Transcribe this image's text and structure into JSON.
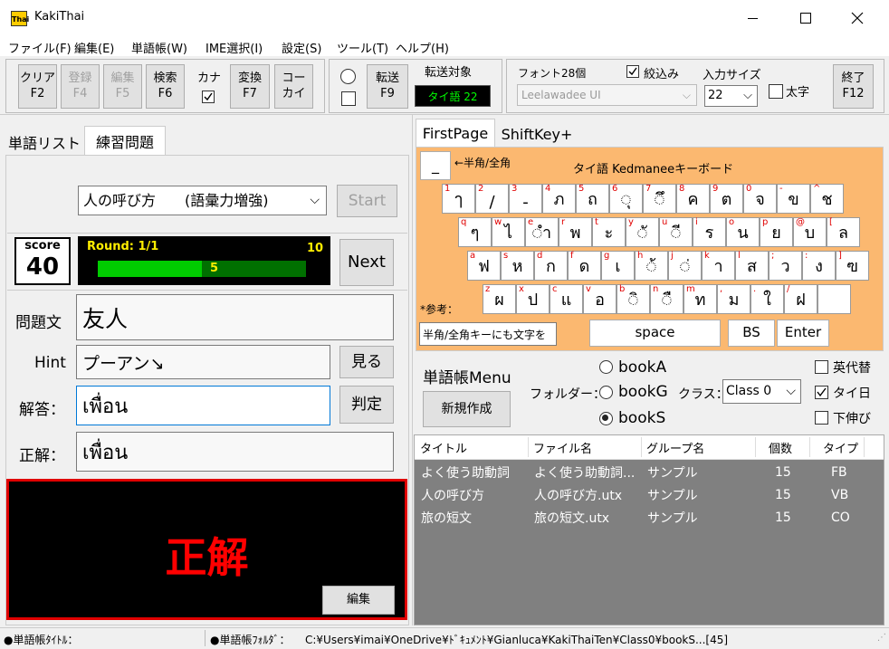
{
  "window": {
    "title": "KakiThai"
  },
  "menu": [
    "ファイル(F)",
    "編集(E)",
    "単語帳(W)",
    "IME選択(I)",
    "設定(S)",
    "ツール(T)",
    "ヘルプ(H)"
  ],
  "toolbar": {
    "clear": {
      "label": "クリア",
      "key": "F2"
    },
    "register": {
      "label": "登録",
      "key": "F4"
    },
    "edit": {
      "label": "編集",
      "key": "F5"
    },
    "search": {
      "label": "検索",
      "key": "F6"
    },
    "kana_label": "カナ",
    "convert": {
      "label": "変換",
      "key": "F7"
    },
    "kokai": {
      "label": "コー",
      "key": "カイ"
    },
    "transfer": {
      "label": "転送",
      "key": "F9"
    },
    "transfer_target_label": "転送対象",
    "transfer_target": "タイ語 22",
    "font_label": "フォント28個",
    "filter_label": "絞込み",
    "font_value": "Leelawadee UI",
    "input_size_label": "入力サイズ",
    "input_size_value": "22",
    "bold_label": "太字",
    "exit": {
      "label": "終了",
      "key": "F12"
    }
  },
  "left_tabs": [
    "単語リスト",
    "練習問題"
  ],
  "quiz": {
    "mode_value": "人の呼び方　　(語彙力増強)",
    "start_label": "Start",
    "score_label": "score",
    "score_value": "40",
    "round_label": "Round: 1/1",
    "progress_max": "10",
    "progress_value": "5",
    "progress_fraction": 0.5,
    "next_label": "Next",
    "question_label": "問題文",
    "question_value": "友人",
    "hint_label": "Hint",
    "hint_value": "プーアン↘",
    "show_label": "見る",
    "answer_label": "解答：",
    "answer_value": "เพื่อน",
    "judge_label": "判定",
    "correct_label": "正解：",
    "correct_value": "เพื่อน",
    "result_text": "正解",
    "edit_label": "編集"
  },
  "right_tabs": [
    "FirstPage",
    "ShiftKey+"
  ],
  "keyboard": {
    "toggle_key": "_",
    "toggle_label": "←半角/全角",
    "title": "タイ語 Kedmaneeキーボード",
    "rows": [
      [
        {
          "s": "1",
          "m": "ๅ"
        },
        {
          "s": "2",
          "m": "/"
        },
        {
          "s": "3",
          "m": "-"
        },
        {
          "s": "4",
          "m": "ภ"
        },
        {
          "s": "5",
          "m": "ถ"
        },
        {
          "s": "6",
          "m": "◌ุ"
        },
        {
          "s": "7",
          "m": "◌ึ"
        },
        {
          "s": "8",
          "m": "ค"
        },
        {
          "s": "9",
          "m": "ต"
        },
        {
          "s": "0",
          "m": "จ"
        },
        {
          "s": "-",
          "m": "ข"
        },
        {
          "s": "^",
          "m": "ช"
        }
      ],
      [
        {
          "s": "q",
          "m": "ๆ"
        },
        {
          "s": "w",
          "m": "ไ"
        },
        {
          "s": "e",
          "m": "◌ำ"
        },
        {
          "s": "r",
          "m": "พ"
        },
        {
          "s": "t",
          "m": "ะ"
        },
        {
          "s": "y",
          "m": "◌ั"
        },
        {
          "s": "u",
          "m": "◌ี"
        },
        {
          "s": "i",
          "m": "ร"
        },
        {
          "s": "o",
          "m": "น"
        },
        {
          "s": "p",
          "m": "ย"
        },
        {
          "s": "@",
          "m": "บ"
        },
        {
          "s": "[",
          "m": "ล"
        }
      ],
      [
        {
          "s": "a",
          "m": "ฟ"
        },
        {
          "s": "s",
          "m": "ห"
        },
        {
          "s": "d",
          "m": "ก"
        },
        {
          "s": "f",
          "m": "ด"
        },
        {
          "s": "g",
          "m": "เ"
        },
        {
          "s": "h",
          "m": "◌้"
        },
        {
          "s": "j",
          "m": "◌่"
        },
        {
          "s": "k",
          "m": "า"
        },
        {
          "s": "l",
          "m": "ส"
        },
        {
          "s": ";",
          "m": "ว"
        },
        {
          "s": ":",
          "m": "ง"
        },
        {
          "s": "]",
          "m": "ฃ"
        }
      ],
      [
        {
          "s": "z",
          "m": "ผ"
        },
        {
          "s": "x",
          "m": "ป"
        },
        {
          "s": "c",
          "m": "แ"
        },
        {
          "s": "v",
          "m": "อ"
        },
        {
          "s": "b",
          "m": "◌ิ"
        },
        {
          "s": "n",
          "m": "◌ื"
        },
        {
          "s": "m",
          "m": "ท"
        },
        {
          "s": ",",
          "m": "ม"
        },
        {
          "s": ".",
          "m": "ใ"
        },
        {
          "s": "/",
          "m": "ฝ"
        },
        {
          "s": "",
          "m": ""
        }
      ]
    ],
    "ref_label": "*参考：",
    "hint_field": "半角/全角キーにも文字を",
    "space_label": "space",
    "bs_label": "BS",
    "enter_label": "Enter"
  },
  "book_menu": {
    "title": "単語帳Menu",
    "new_label": "新規作成",
    "folder_label": "フォルダー：",
    "folders": [
      "bookA",
      "bookG",
      "bookS"
    ],
    "selected_folder": "bookS",
    "class_label": "クラス：",
    "class_value": "Class 0",
    "options": [
      {
        "label": "英代替",
        "checked": false
      },
      {
        "label": "タイ日",
        "checked": true
      },
      {
        "label": "下伸び",
        "checked": false
      }
    ]
  },
  "book_table": {
    "headers": [
      "タイトル",
      "ファイル名",
      "グループ名",
      "個数",
      "タイプ"
    ],
    "rows": [
      [
        "よく使う助動詞",
        "よく使う助動詞...",
        "サンプル",
        "15",
        "FB"
      ],
      [
        "人の呼び方",
        "人の呼び方.utx",
        "サンプル",
        "15",
        "VB"
      ],
      [
        "旅の短文",
        "旅の短文.utx",
        "サンプル",
        "15",
        "CO"
      ]
    ]
  },
  "status": {
    "title_label": "●単語帳ﾀｲﾄﾙ：",
    "folder_label": "●単語帳ﾌｫﾙﾀﾞ：",
    "folder_path": "C:¥Users¥imai¥OneDrive¥ﾄﾞｷｭﾒﾝﾄ¥Gianluca¥KakiThaiTen¥Class0¥bookS...[45]"
  },
  "colors": {
    "keyboard_bg": "#fbb870",
    "result_border": "#e00000",
    "result_text": "#ff0000",
    "target_text": "#00ff00",
    "progress": "#00cc00",
    "table_bg": "#808080"
  }
}
